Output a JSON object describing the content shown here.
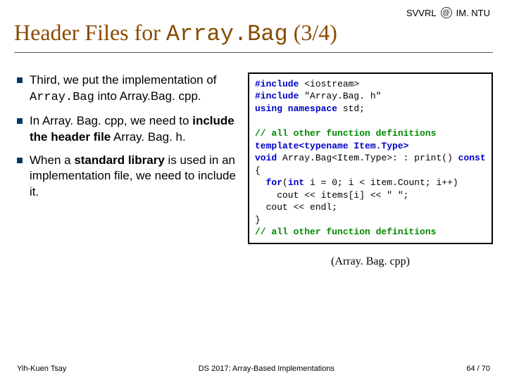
{
  "header": {
    "left_label": "SVVRL",
    "right_label": "IM. NTU"
  },
  "title": {
    "prefix": "Header Files for ",
    "code": "Array.Bag",
    "suffix": " (3/4)"
  },
  "bullets": [
    {
      "pre": "Third, we put the implementation of ",
      "code": "Array.Bag",
      "post": " into Array.Bag. cpp."
    },
    {
      "pre": "In Array. Bag. cpp, we need to ",
      "bold": "include the header file",
      "post": " Array. Bag. h."
    },
    {
      "pre": "When a ",
      "bold": "standard library",
      "post": " is used in an implementation file, we need to include it."
    }
  ],
  "code": {
    "l1a": "#include ",
    "l1b": "<iostream>",
    "l2a": "#include ",
    "l2b": "\"Array.Bag. h\"",
    "l3a": "using namespace ",
    "l3b": "std;",
    "blank1": "",
    "c1": "// all other function definitions",
    "l4": "template<typename Item.Type>",
    "l5a": "void ",
    "l5b": "Array.Bag<Item.Type>: : print() ",
    "l5c": "const",
    "l6": "{",
    "l7a": "  for",
    "l7b": "(",
    "l7c": "int ",
    "l7d": "i = 0; i < item.Count; i++)",
    "l8": "    cout << items[i] << \" \";",
    "l9": "  cout << endl;",
    "l10": "}",
    "c2": "// all other function definitions"
  },
  "caption": "(Array. Bag. cpp)",
  "footer": {
    "left": "Yih-Kuen Tsay",
    "center": "DS 2017: Array-Based Implementations",
    "right": "64 / 70"
  }
}
